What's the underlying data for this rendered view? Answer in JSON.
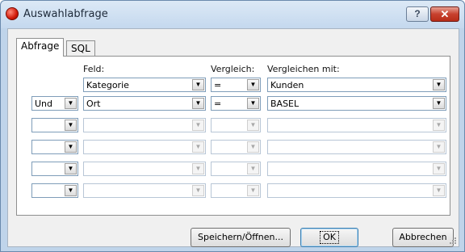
{
  "window": {
    "title": "Auswahlabfrage",
    "help_label": "?",
    "close_label": "✕"
  },
  "tabs": [
    {
      "label": "Abfrage",
      "active": true
    },
    {
      "label": "SQL",
      "active": false
    }
  ],
  "headers": {
    "field": "Feld:",
    "comparison": "Vergleich:",
    "compare_with": "Vergleichen mit:"
  },
  "rows": [
    {
      "conjunction": "",
      "field": "Kategorie",
      "operator": "=",
      "value": "Kunden",
      "enabled": true
    },
    {
      "conjunction": "Und",
      "field": "Ort",
      "operator": "=",
      "value": "BASEL",
      "enabled": true
    },
    {
      "conjunction": "",
      "field": "",
      "operator": "",
      "value": "",
      "enabled": false
    },
    {
      "conjunction": "",
      "field": "",
      "operator": "",
      "value": "",
      "enabled": false
    },
    {
      "conjunction": "",
      "field": "",
      "operator": "",
      "value": "",
      "enabled": false
    },
    {
      "conjunction": "",
      "field": "",
      "operator": "",
      "value": "",
      "enabled": false
    }
  ],
  "buttons": {
    "save_open": "Speichern/Öffnen...",
    "ok": "OK",
    "cancel": "Abbrechen"
  },
  "icons": {
    "dropdown": "chevron-down-icon",
    "app": "red-ball-icon",
    "help": "help-icon",
    "close": "close-icon"
  },
  "colors": {
    "titlebar": "#c4d8ee",
    "close_button": "#c7412e",
    "dialog_bg": "#f0f0f0"
  }
}
